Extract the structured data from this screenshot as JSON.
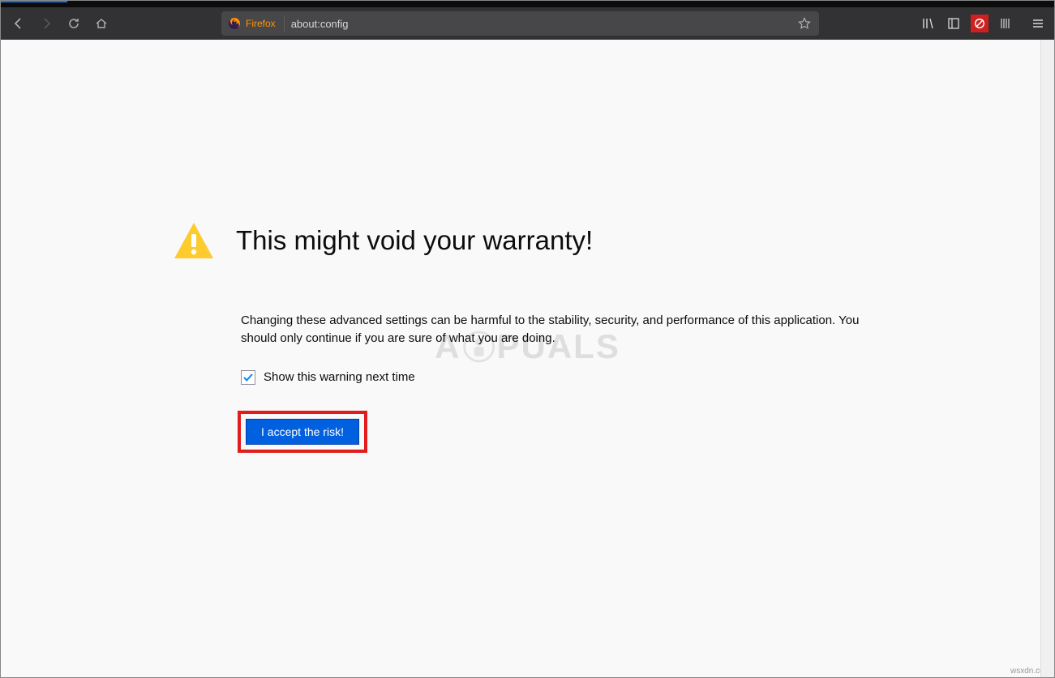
{
  "urlbar": {
    "identity": "Firefox",
    "url": "about:config"
  },
  "warning": {
    "title": "This might void your warranty!",
    "description": "Changing these advanced settings can be harmful to the stability, security, and performance of this application. You should only continue if you are sure of what you are doing.",
    "checkbox_label": "Show this warning next time",
    "checkbox_checked": true,
    "button_label": "I accept the risk!"
  },
  "watermark": {
    "pre": "A",
    "post": "PUALS"
  },
  "attribution": "wsxdn.com",
  "toolbar_icons": [
    "library",
    "sidebar",
    "noscript",
    "grid",
    "menu"
  ],
  "colors": {
    "toolbar_bg": "#323234",
    "urlbar_bg": "#474749",
    "accent_orange": "#ff9400",
    "button_blue": "#0060df",
    "highlight_red": "#e21b1b",
    "warning_yellow": "#fecb2f",
    "check_blue": "#0a84ff"
  }
}
